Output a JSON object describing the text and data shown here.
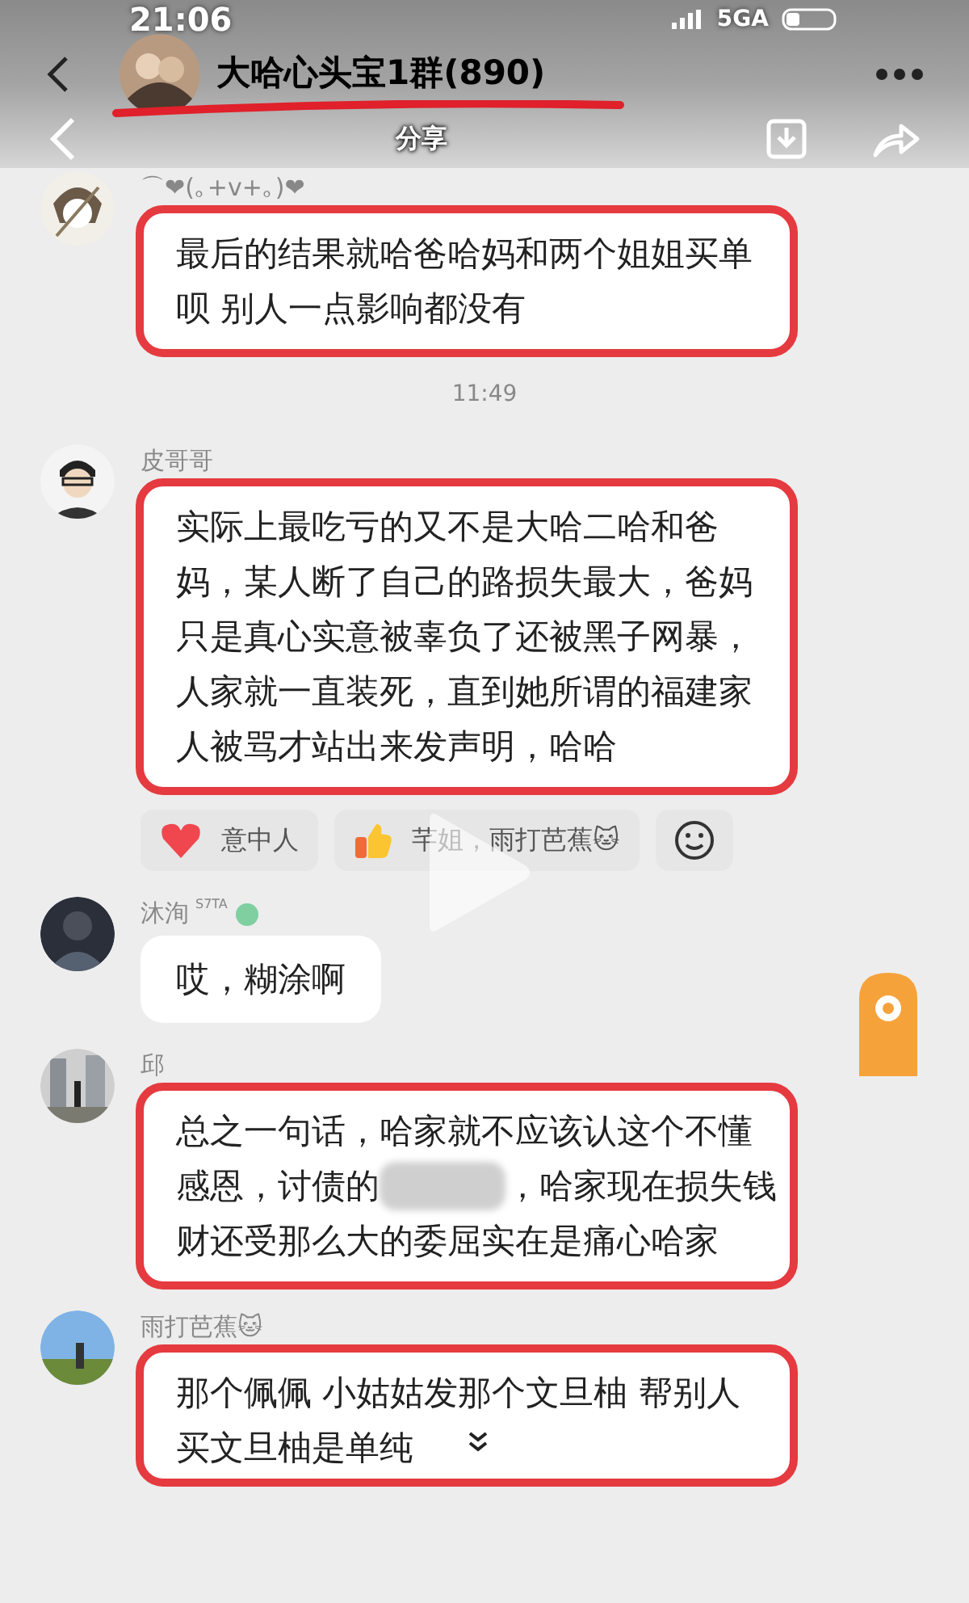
{
  "status_bar": {
    "time": "21:06",
    "network": "5GA"
  },
  "header": {
    "title": "大哈心头宝1群(890)",
    "underlined": true
  },
  "share_bar": {
    "title": "分享"
  },
  "messages": [
    {
      "kind": "text",
      "sender": "⌒❤(｡+v+｡)❤",
      "text": "最后的结果就哈爸哈妈和两个姐姐买单呗 别人一点影响都没有",
      "highlighted": true
    },
    {
      "kind": "time",
      "text": "11:49"
    },
    {
      "kind": "text",
      "sender": "皮哥哥",
      "text": "实际上最吃亏的又不是大哈二哈和爸妈，某人断了自己的路损失最大，爸妈只是真心实意被辜负了还被黑子网暴，人家就一直装死，直到她所谓的福建家人被骂才站出来发声明，哈哈",
      "highlighted": true,
      "reactions": [
        {
          "kind": "heart",
          "text": "意中人"
        },
        {
          "kind": "thumb",
          "text": "芊姐，雨打芭蕉🐱"
        }
      ]
    },
    {
      "kind": "text",
      "sender": "沐洵",
      "sender_tag": "S7TA",
      "text": "哎，糊涂啊",
      "highlighted": false
    },
    {
      "kind": "text",
      "sender": "邱",
      "lines": [
        "总之一句话，哈家就不应该认这个不懂",
        "感恩，讨债的",
        "，哈家现在损失钱",
        "财还受那么大的委屈实在是痛心哈家"
      ],
      "blurred": true,
      "highlighted": true
    },
    {
      "kind": "text",
      "sender": "雨打芭蕉🐱",
      "text": "那个佩佩 小姑姑发那个文旦柚 帮别人买文旦柚是单纯",
      "highlighted": true,
      "collapsed": true
    }
  ]
}
